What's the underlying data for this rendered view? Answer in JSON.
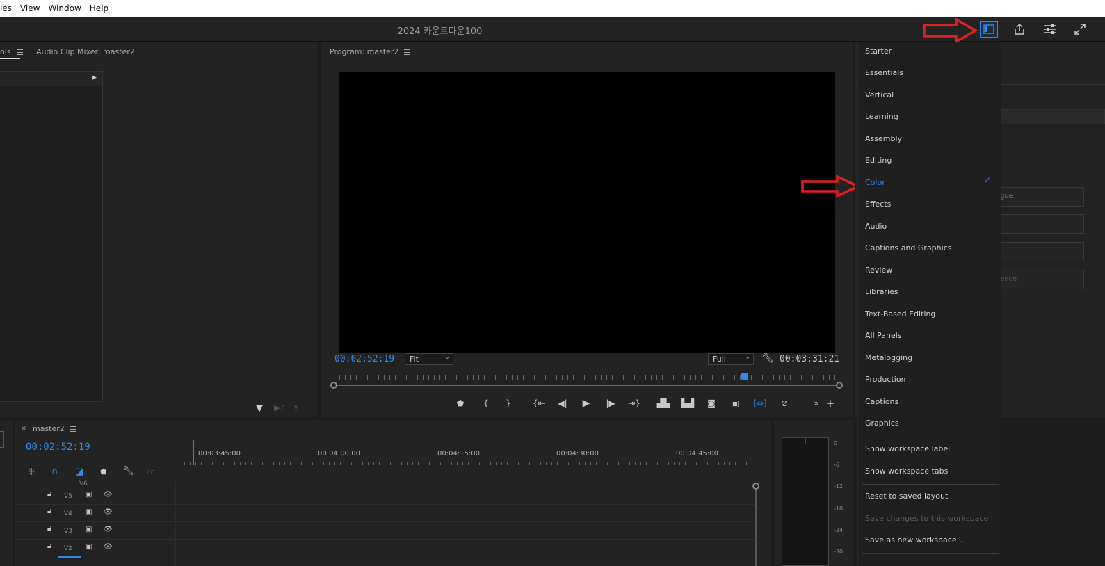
{
  "menubar": {
    "items": [
      "les",
      "View",
      "Window",
      "Help"
    ]
  },
  "titlebar": {
    "title": "2024 카운트다운100"
  },
  "left_panel": {
    "tab_partial": "ols",
    "tab_audio_mixer": "Audio Clip Mixer: master2"
  },
  "program": {
    "tab_label": "Program: master2",
    "current_time": "00:02:52:19",
    "fit_label": "Fit",
    "quality_label": "Full",
    "duration": "00:03:31:21"
  },
  "timeline": {
    "tab_label": "master2",
    "current_time": "00:02:52:19",
    "ruler_times": [
      "00:03:45:00",
      "00:04:00:00",
      "00:04:15:00",
      "00:04:30:00",
      "00:04:45:00"
    ],
    "tracks": [
      "V6",
      "V5",
      "V4",
      "V3",
      "V2"
    ]
  },
  "meter": {
    "scale": [
      "0",
      "-6",
      "-12",
      "-18",
      "-24",
      "-30"
    ]
  },
  "workspace_menu": {
    "items": [
      "Starter",
      "Essentials",
      "Vertical",
      "Learning",
      "Assembly",
      "Editing",
      "Color",
      "Effects",
      "Audio",
      "Captions and Graphics",
      "Review",
      "Libraries",
      "Text-Based Editing",
      "All Panels",
      "Metalogging",
      "Production",
      "Captions",
      "Graphics"
    ],
    "selected": "Color",
    "options": [
      "Show workspace label",
      "Show workspace tabs"
    ],
    "actions": [
      "Reset to saved layout",
      "Save changes to this workspace",
      "Save as new workspace..."
    ]
  },
  "right_panel": {
    "field_fragments": [
      "gue",
      "ence"
    ]
  },
  "colors": {
    "accent": "#2d8ceb",
    "annotation_red": "#e02020"
  }
}
